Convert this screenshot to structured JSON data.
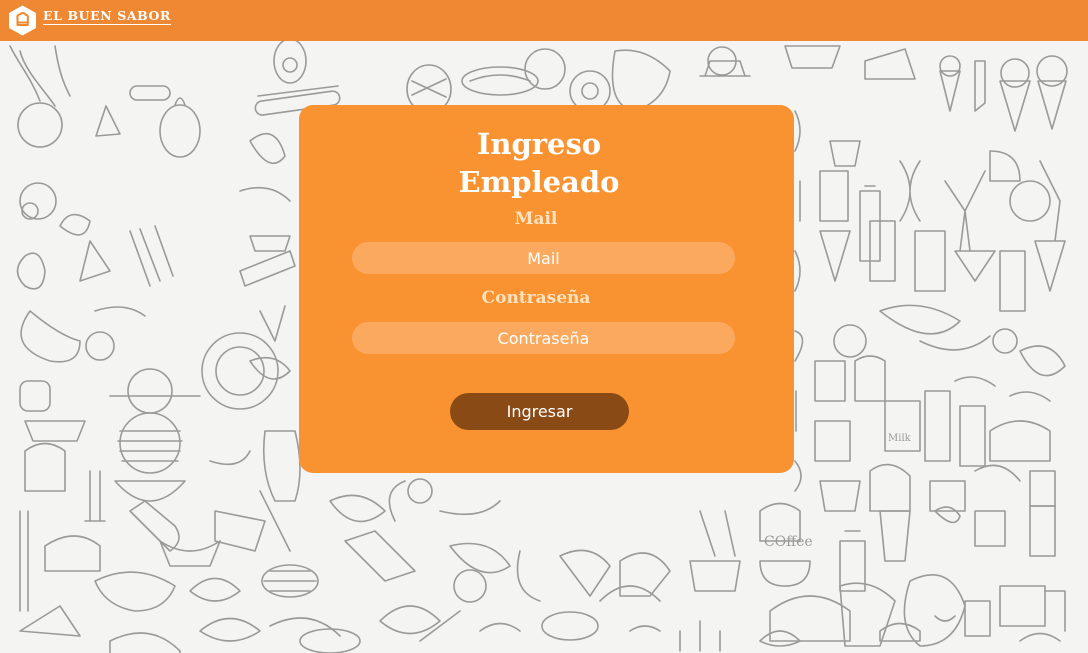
{
  "header": {
    "brand": "EL BUEN SABOR",
    "logo_icon": "chef-hat-icon",
    "background_color": "#ef8833"
  },
  "background": {
    "style": "food-doodle-pattern",
    "stroke_color": "#9a9a9a",
    "fill_color": "#f4f4f3",
    "doodle_text": {
      "coffee": "COffee",
      "milk": "Milk"
    }
  },
  "login": {
    "title": "Ingreso\nEmpleado",
    "mail_label": "Mail",
    "mail_placeholder": "Mail",
    "password_label": "Contraseña",
    "password_placeholder": "Contraseña",
    "submit_label": "Ingresar",
    "card_color": "#f99230",
    "button_color": "#8a4a16"
  }
}
